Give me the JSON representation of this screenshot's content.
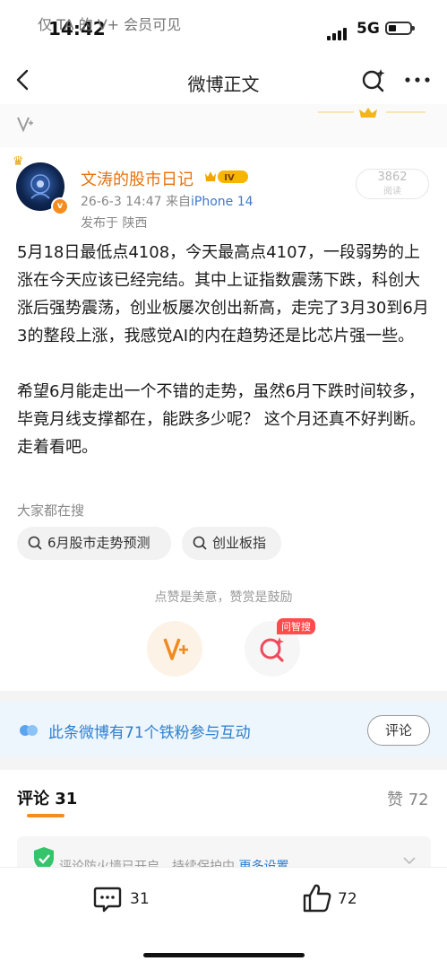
{
  "status_bar": {
    "time": "14:42",
    "network": "5G"
  },
  "nav": {
    "title": "微博正文",
    "icons": [
      "back-arrow-icon",
      "ai-search-icon",
      "more-dots-icon"
    ]
  },
  "vip_bar": {
    "text": "仅 TA 的 V+ 会员可见"
  },
  "post": {
    "author": "文涛的股市日记",
    "level_badge": "IV",
    "date": "26-6-3 14:47",
    "source_prefix": "来自",
    "device": "iPhone 14",
    "location": "发布于 陕西",
    "read_count": "3862",
    "read_label": "阅读",
    "paragraphs": [
      "5月18日最低点4108，今天最高点4107，一段弱势的上涨在今天应该已经完结。其中上证指数震荡下跌，科创大涨后强势震荡，创业板屡次创出新高，走完了3月30到6月3的整段上涨，我感觉AI的内在趋势还是比芯片强一些。",
      "希望6月能走出一个不错的走势，虽然6月下跌时间较多，毕竟月线支撑都在，能跌多少呢？ 这个月还真不好判断。走着看吧。"
    ]
  },
  "hot_search": {
    "title": "大家都在搜",
    "chips": [
      "6月股市走势预测",
      "创业板指"
    ]
  },
  "reward": {
    "text": "点赞是美意，赞赏是鼓励",
    "ask_tag": "问智搜"
  },
  "fans_banner": {
    "text": "此条微博有71个铁粉参与互动",
    "button": "评论"
  },
  "comments": {
    "tab_label": "评论 31",
    "like_label": "赞 72",
    "notice": "评论防火墙已开启，持续保护中",
    "notice_link": "更多设置"
  },
  "bottom_bar": {
    "comment_count": "31",
    "like_count": "72"
  },
  "colors": {
    "accent_orange": "#f68c1e",
    "link_blue": "#2d7fd0",
    "username_orange": "#e8720c"
  }
}
